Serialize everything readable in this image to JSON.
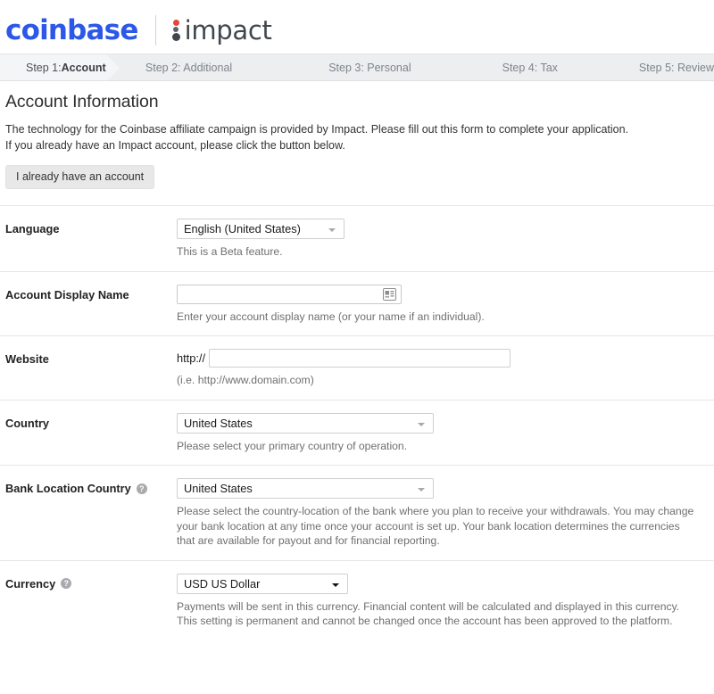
{
  "header": {
    "brand_primary": "coinbase",
    "brand_secondary": "impact",
    "brand_primary_color": "#2B58E8",
    "impact_dot_red": "#E8433B",
    "impact_dark": "#41474E"
  },
  "steps": [
    {
      "label": "Step 1: ",
      "emphasis": "Account",
      "active": true
    },
    {
      "label": "Step 2: Additional",
      "active": false
    },
    {
      "label": "Step 3: Personal",
      "active": false
    },
    {
      "label": "Step 4: Tax",
      "active": false
    },
    {
      "label": "Step 5: Review",
      "active": false
    }
  ],
  "page": {
    "title": "Account Information",
    "intro_line1": "The technology for the Coinbase affiliate campaign is provided by Impact. Please fill out this form to complete your application.",
    "intro_line2": "If you already have an Impact account, please click the button below.",
    "existing_account_button": "I already have an account"
  },
  "form": {
    "language": {
      "label": "Language",
      "value": "English (United States)",
      "hint": "This is a Beta feature."
    },
    "account_display_name": {
      "label": "Account Display Name",
      "value": "",
      "placeholder": "",
      "hint": "Enter your account display name (or your name if an individual).",
      "icon": "contact-card-icon"
    },
    "website": {
      "label": "Website",
      "prefix": "http://",
      "value": "",
      "placeholder": "",
      "hint": "(i.e. http://www.domain.com)"
    },
    "country": {
      "label": "Country",
      "value": "United States",
      "hint": "Please select your primary country of operation."
    },
    "bank_location_country": {
      "label": "Bank Location Country",
      "help_icon": "?",
      "value": "United States",
      "hint": "Please select the country-location of the bank where you plan to receive your withdrawals. You may change your bank location at any time once your account is set up. Your bank location determines the currencies that are available for payout and for financial reporting."
    },
    "currency": {
      "label": "Currency",
      "help_icon": "?",
      "value": "USD US Dollar",
      "hint": "Payments will be sent in this currency. Financial content will be calculated and displayed in this currency. This setting is permanent and cannot be changed once the account has been approved to the platform."
    }
  }
}
